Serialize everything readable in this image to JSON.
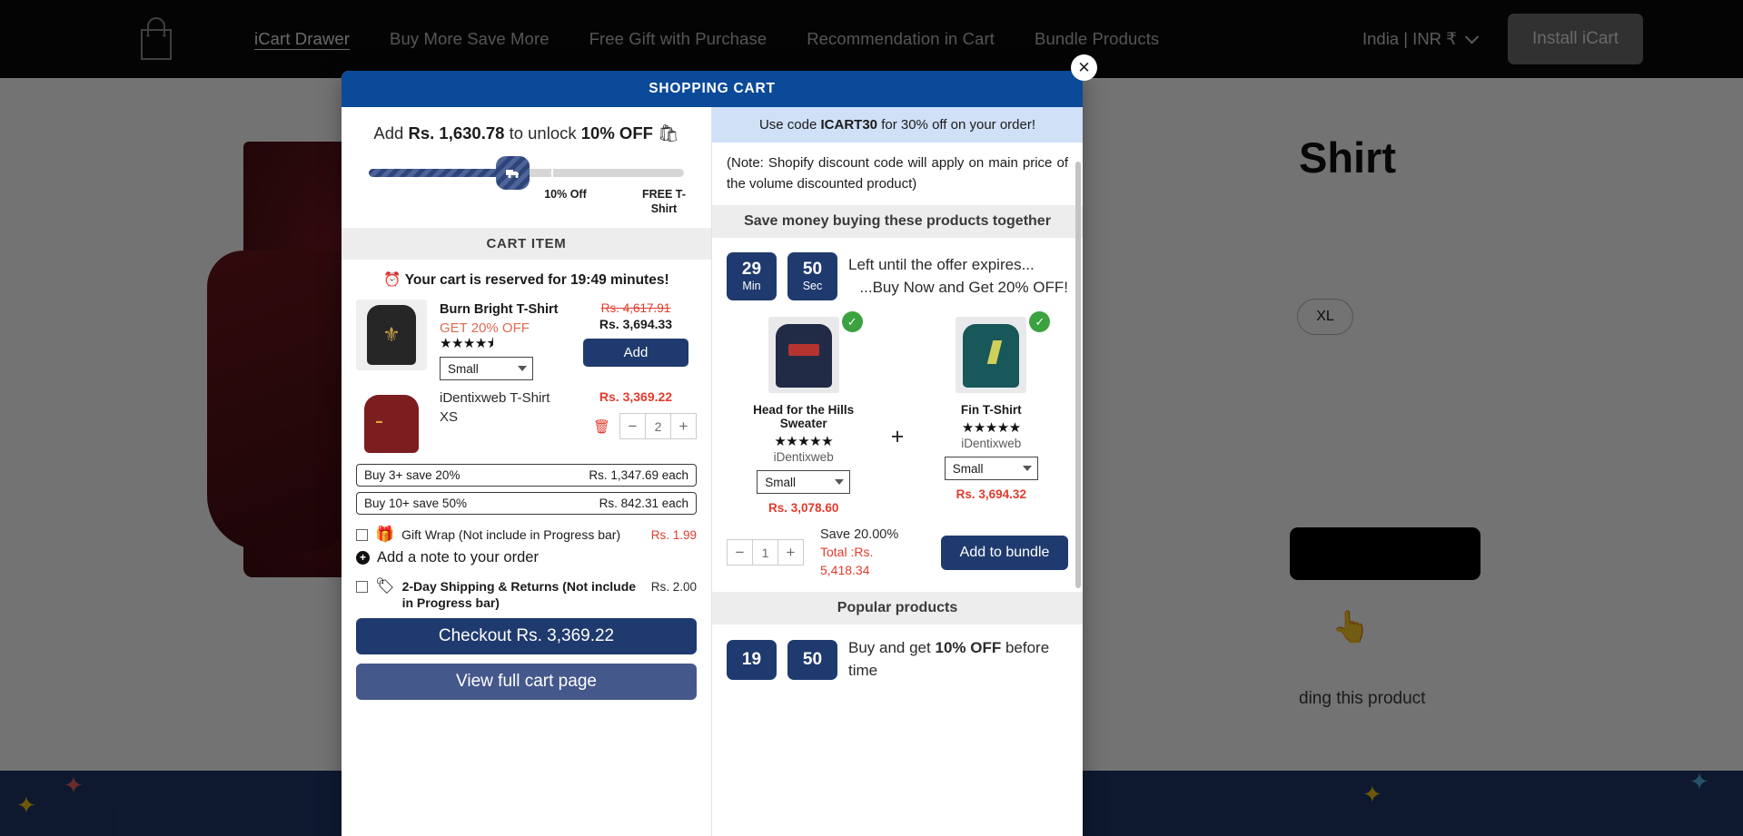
{
  "topbar": {
    "logo_icon": "shopping-bag-icon",
    "nav": [
      {
        "label": "iCart Drawer",
        "active": true
      },
      {
        "label": "Buy More Save More",
        "active": false
      },
      {
        "label": "Free Gift with Purchase",
        "active": false
      },
      {
        "label": "Recommendation in Cart",
        "active": false
      },
      {
        "label": "Bundle Products",
        "active": false
      }
    ],
    "locale": "India | INR ₹",
    "install_label": "Install iCart"
  },
  "pdp": {
    "title": "Shirt",
    "size_pill": "XL",
    "note": "ding this product",
    "hand_icon": "pointing-hand-icon"
  },
  "modal": {
    "header_title": "SHOPPING CART",
    "close_icon": "close-icon"
  },
  "progress": {
    "prefix": "Add",
    "amount": "Rs. 1,630.78",
    "middle": "to unlock",
    "discount": "10% OFF",
    "emoji": "🛍",
    "truck_icon": "delivery-truck-icon",
    "milestones": [
      {
        "label": "10% Off",
        "pos_pct": 58
      },
      {
        "label": "FREE T-Shirt",
        "pos_pct": 93
      }
    ]
  },
  "cart": {
    "section_title": "CART ITEM",
    "reserved_icon": "alarm-clock-icon",
    "reserved_text": "Your cart is reserved for 19:49 minutes!",
    "items": [
      {
        "name": "Burn Bright T-Shirt",
        "offer": "GET 20% OFF",
        "rating": 4.5,
        "variant_label": "Small",
        "price_old": "Rs. 4,617.91",
        "price_new": "Rs. 3,694.33",
        "action_label": "Add",
        "thumb": "black-tshirt-thumb"
      },
      {
        "name": "iDentixweb T-Shirt",
        "variant": "XS",
        "price": "Rs. 3,369.22",
        "quantity": "2",
        "thumb": "maroon-polo-thumb",
        "delete_icon": "trash-icon"
      }
    ],
    "tiers": [
      {
        "label": "Buy 3+ save 20%",
        "price": "Rs. 1,347.69 each"
      },
      {
        "label": "Buy 10+ save 50%",
        "price": "Rs. 842.31 each"
      }
    ],
    "gift_wrap": {
      "icon": "gift-icon",
      "label": "Gift Wrap (Not include in Progress bar)",
      "price": "Rs. 1.99",
      "checked": false
    },
    "note_link": "Add a note to your order",
    "shipping": {
      "icon": "shipping-label-icon",
      "label": "2-Day Shipping & Returns (Not include in Progress bar)",
      "price": "Rs. 2.00",
      "checked": false
    },
    "checkout_label": "Checkout Rs. 3,369.22",
    "view_cart_label": "View full cart page"
  },
  "promo": {
    "prefix": "Use code",
    "code": "ICART30",
    "suffix": "for 30% off on your order!",
    "note": "(Note: Shopify discount code will apply on main price of the volume discounted product)"
  },
  "bundle": {
    "heading": "Save money buying these products together",
    "timer": {
      "min": "29",
      "min_label": "Min",
      "sec": "50",
      "sec_label": "Sec"
    },
    "timer_line1": "Left until the offer expires...",
    "timer_line2": "...Buy Now and Get 20% OFF!",
    "plus_separator": "+",
    "products": [
      {
        "title": "Head for the Hills Sweater",
        "rating": 5,
        "vendor": "iDentixweb",
        "variant_label": "Small",
        "price": "Rs. 3,078.60",
        "selected": true,
        "check_icon": "check-circle-icon",
        "thumb": "navy-sweater-thumb"
      },
      {
        "title": "Fin T-Shirt",
        "rating": 5,
        "vendor": "iDentixweb",
        "variant_label": "Small",
        "price": "Rs. 3,694.32",
        "selected": true,
        "check_icon": "check-circle-icon",
        "thumb": "teal-tshirt-thumb"
      }
    ],
    "quantity": "1",
    "save_label": "Save 20.00%",
    "total_prefix": "Total :",
    "total_value": "Rs. 5,418.34",
    "add_label": "Add to bundle"
  },
  "popular": {
    "heading": "Popular products",
    "timer": {
      "min": "19",
      "sec": "50"
    },
    "text_prefix": "Buy and get",
    "text_bold": "10% OFF",
    "text_suffix": "before time"
  },
  "colors": {
    "brand_navy": "#1f3a6e",
    "header_blue": "#0b4a99",
    "promo_blue": "#cfe0f7",
    "danger_red": "#e23b2e",
    "offer_orange": "#e06a52",
    "success_green": "#3aa23f"
  }
}
